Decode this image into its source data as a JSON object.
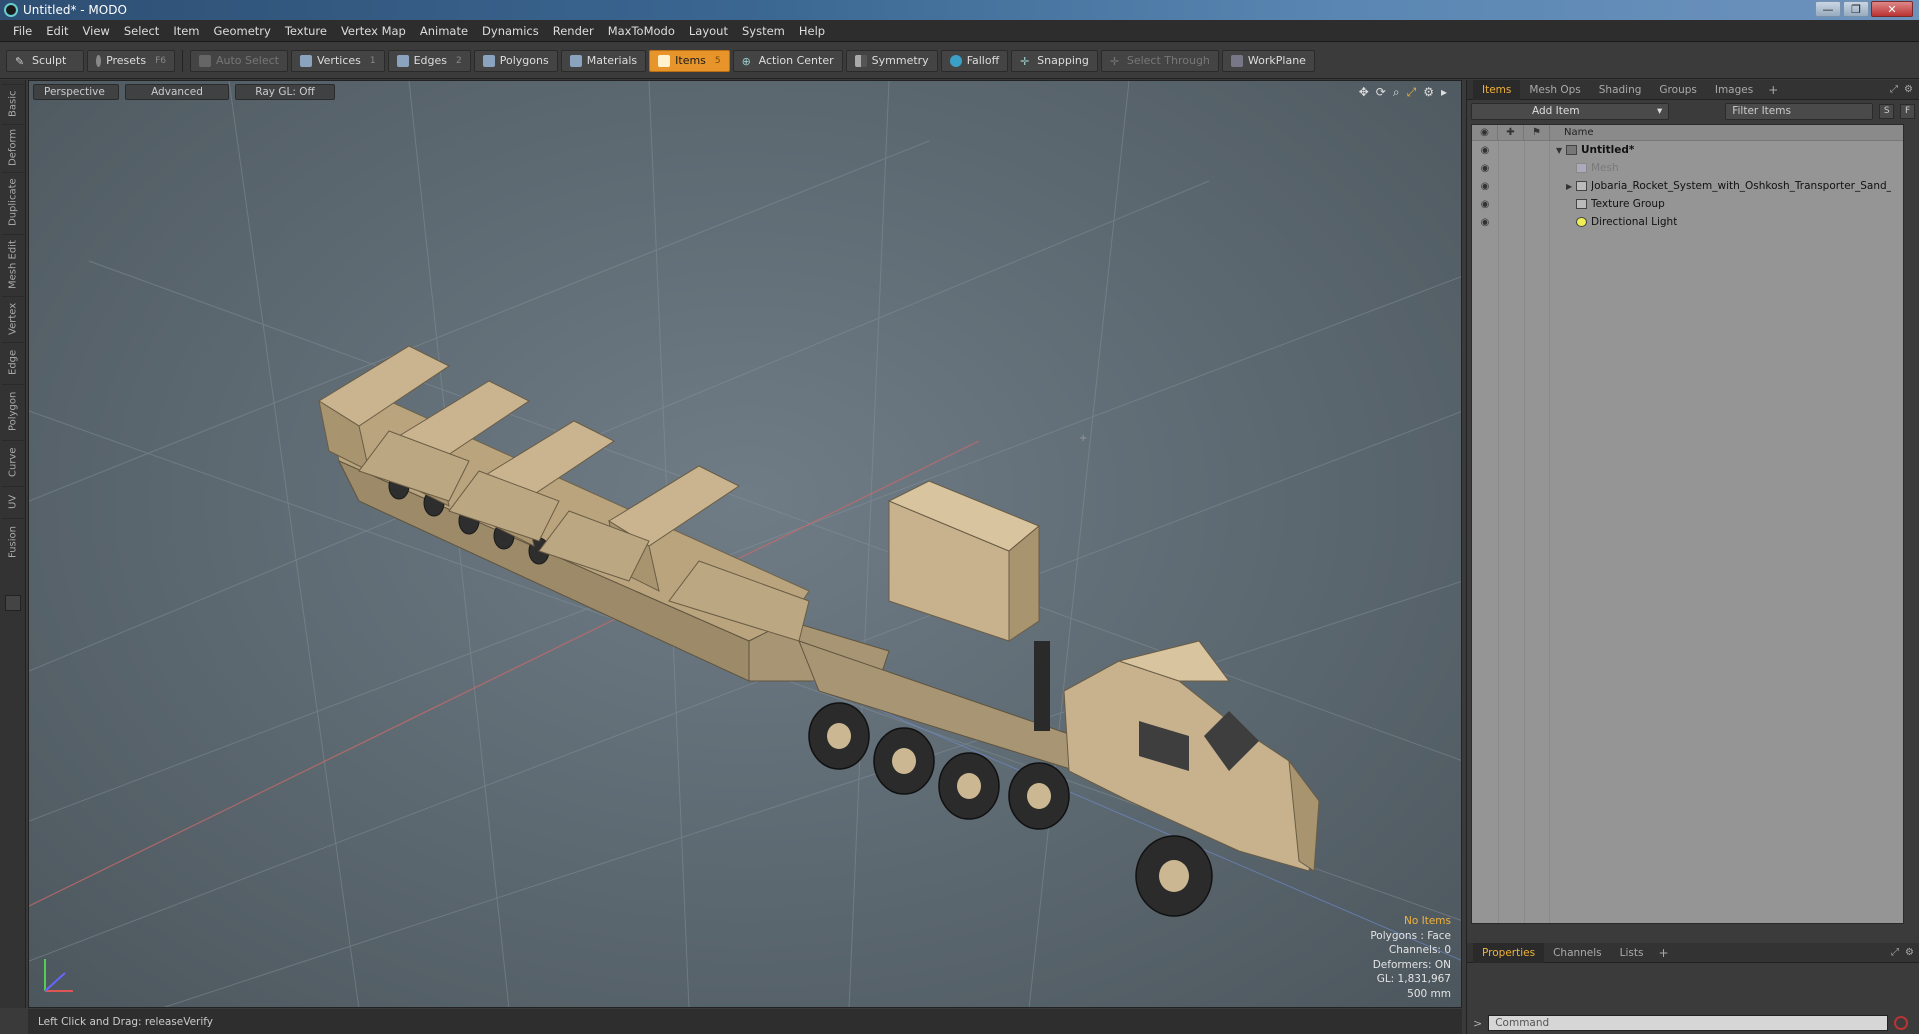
{
  "window": {
    "title": "Untitled* - MODO"
  },
  "menu": [
    "File",
    "Edit",
    "View",
    "Select",
    "Item",
    "Geometry",
    "Texture",
    "Vertex Map",
    "Animate",
    "Dynamics",
    "Render",
    "MaxToModo",
    "Layout",
    "System",
    "Help"
  ],
  "toolbar": {
    "sculpt": "Sculpt",
    "presets": "Presets",
    "presets_key": "F6",
    "auto_select": "Auto Select",
    "vertices": "Vertices",
    "vertices_key": "1",
    "edges": "Edges",
    "edges_key": "2",
    "polygons": "Polygons",
    "materials": "Materials",
    "items": "Items",
    "items_key": "5",
    "action_center": "Action Center",
    "symmetry": "Symmetry",
    "falloff": "Falloff",
    "snapping": "Snapping",
    "select_through": "Select Through",
    "workplane": "WorkPlane"
  },
  "left_tabs": [
    "Basic",
    "Deform",
    "Duplicate",
    "Mesh Edit",
    "Vertex",
    "Edge",
    "Polygon",
    "Curve",
    "UV",
    "Fusion"
  ],
  "viewport": {
    "view_mode": "Perspective",
    "shading": "Advanced",
    "raygl": "Ray GL: Off",
    "stats": {
      "no_items": "No Items",
      "polygons": "Polygons : Face",
      "channels": "Channels: 0",
      "deformers": "Deformers: ON",
      "gl": "GL: 1,831,967",
      "scale": "500 mm"
    }
  },
  "status": {
    "hint": "Left Click and Drag:  releaseVerify"
  },
  "items_panel": {
    "tabs": [
      "Items",
      "Mesh Ops",
      "Shading",
      "Groups",
      "Images"
    ],
    "active_tab": "Items",
    "add_item": "Add Item",
    "filter_placeholder": "Filter Items",
    "btn_s": "S",
    "btn_f": "F",
    "column_name": "Name",
    "tree": [
      {
        "label": "Untitled*",
        "level": 0,
        "bold": true,
        "dim": false,
        "expander": "▼"
      },
      {
        "label": "Mesh",
        "level": 1,
        "bold": false,
        "dim": true,
        "expander": ""
      },
      {
        "label": "Jobaria_Rocket_System_with_Oshkosh_Transporter_Sand_...",
        "level": 1,
        "bold": false,
        "dim": false,
        "expander": "▶"
      },
      {
        "label": "Texture Group",
        "level": 1,
        "bold": false,
        "dim": false,
        "expander": ""
      },
      {
        "label": "Directional Light",
        "level": 1,
        "bold": false,
        "dim": false,
        "expander": ""
      }
    ]
  },
  "properties_panel": {
    "tabs": [
      "Properties",
      "Channels",
      "Lists"
    ],
    "active_tab": "Properties",
    "command_placeholder": "Command"
  },
  "colors": {
    "accent": "#e7952a",
    "highlight_text": "#f0b23b",
    "vehicle_sand": "#c8b38c"
  }
}
